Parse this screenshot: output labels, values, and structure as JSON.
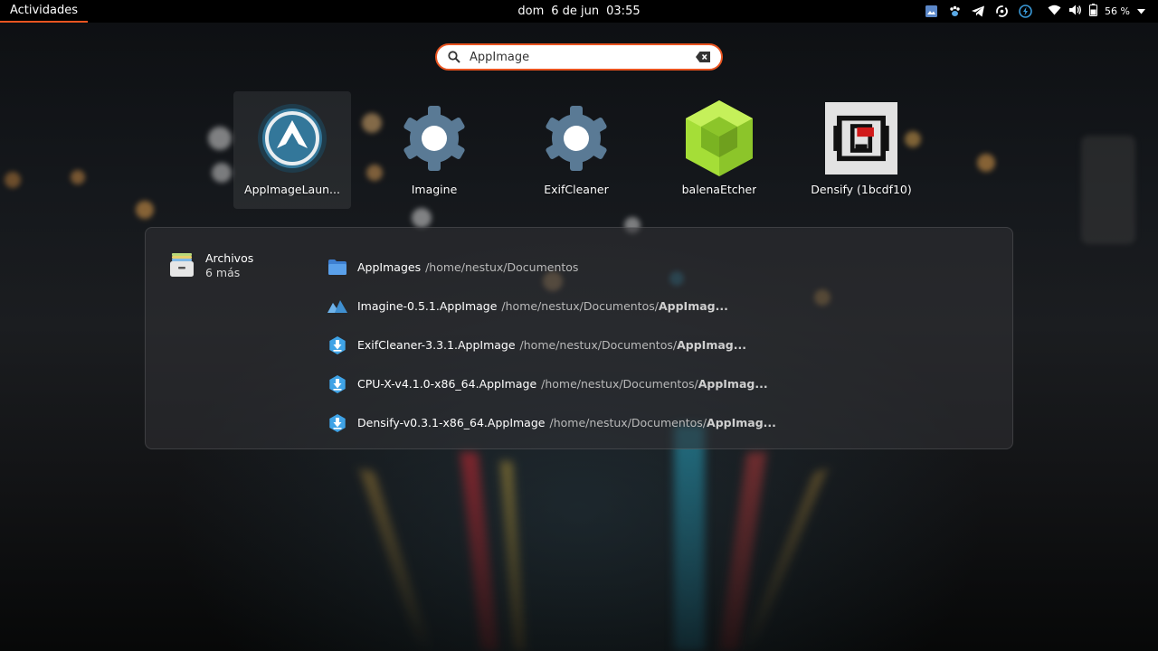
{
  "topbar": {
    "activities": "Actividades",
    "clock_day": "dom",
    "clock_date": "6 de jun",
    "clock_time": "03:55",
    "tray_icons": [
      "screenshot-icon",
      "paw-icon",
      "telegram-icon",
      "sync-icon",
      "power-manager-icon"
    ],
    "battery_percent": "56 %",
    "accent": "#e95420"
  },
  "search": {
    "value": "AppImage"
  },
  "apps": [
    {
      "label": "AppImageLaun...",
      "icon": "appimagelauncher-icon",
      "selected": true
    },
    {
      "label": "Imagine",
      "icon": "gear-icon",
      "selected": false
    },
    {
      "label": "ExifCleaner",
      "icon": "gear-icon",
      "selected": false
    },
    {
      "label": "balenaEtcher",
      "icon": "balena-cube-icon",
      "selected": false
    },
    {
      "label": "Densify (1bcdf10)",
      "icon": "densify-icon",
      "selected": false
    }
  ],
  "files": {
    "provider": "Archivos",
    "more": "6 más",
    "results": [
      {
        "name": "AppImages",
        "path": "/home/nestux/Documentos",
        "path_bold": "",
        "icon": "folder-icon"
      },
      {
        "name": "Imagine-0.5.1.AppImage",
        "path": "/home/nestux/Documentos/",
        "path_bold": "AppImag...",
        "icon": "image-app-icon"
      },
      {
        "name": "ExifCleaner-3.3.1.AppImage",
        "path": "/home/nestux/Documentos/",
        "path_bold": "AppImag...",
        "icon": "appimage-download-icon"
      },
      {
        "name": "CPU-X-v4.1.0-x86_64.AppImage",
        "path": "/home/nestux/Documentos/",
        "path_bold": "AppImag...",
        "icon": "appimage-download-icon"
      },
      {
        "name": "Densify-v0.3.1-x86_64.AppImage",
        "path": "/home/nestux/Documentos/",
        "path_bold": "AppImag...",
        "icon": "appimage-download-icon"
      }
    ]
  }
}
